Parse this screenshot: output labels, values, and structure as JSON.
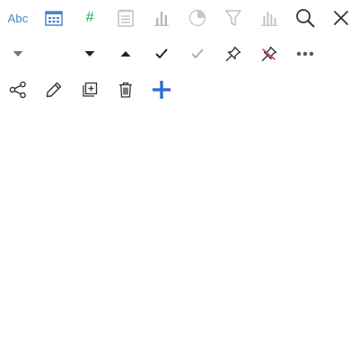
{
  "toolbar": {
    "row1": [
      {
        "name": "text-type-icon",
        "label": "Abc",
        "color": "#4a86c8"
      },
      {
        "name": "calendar-icon",
        "color": "#4a86c8"
      },
      {
        "name": "number-type-icon",
        "label": "#",
        "color": "#2fa84f"
      },
      {
        "name": "notepad-icon",
        "color": "#b8b8b8"
      },
      {
        "name": "bar-chart-icon",
        "color": "#b8b8b8"
      },
      {
        "name": "pie-chart-icon",
        "color": "#c8c8c8"
      },
      {
        "name": "filter-icon",
        "color": "#b8b8b8"
      },
      {
        "name": "histogram-icon",
        "color": "#c0c0c0"
      },
      {
        "name": "search-icon",
        "color": "#333333"
      },
      {
        "name": "close-icon",
        "color": "#333333"
      }
    ],
    "row2": [
      {
        "name": "caret-down-muted-icon",
        "color": "#6b7a8a"
      },
      {
        "name": "caret-down-icon",
        "color": "#222222"
      },
      {
        "name": "caret-up-icon",
        "color": "#222222"
      },
      {
        "name": "checkmark-icon",
        "color": "#222222"
      },
      {
        "name": "checkmark-muted-icon",
        "color": "#b0b0b0"
      },
      {
        "name": "pin-icon",
        "color": "#333333"
      },
      {
        "name": "unpin-icon",
        "color": "#e53950"
      },
      {
        "name": "more-horizontal-icon",
        "color": "#555555"
      }
    ],
    "row3": [
      {
        "name": "share-icon",
        "color": "#333333"
      },
      {
        "name": "edit-pencil-icon",
        "color": "#333333"
      },
      {
        "name": "duplicate-icon",
        "color": "#333333"
      },
      {
        "name": "trash-icon",
        "color": "#333333"
      },
      {
        "name": "add-plus-icon",
        "color": "#2f6fd0"
      }
    ]
  }
}
